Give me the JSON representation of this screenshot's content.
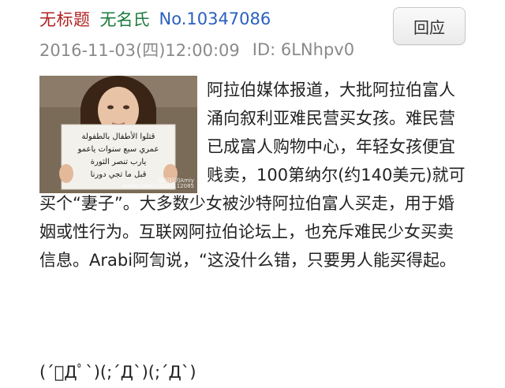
{
  "post": {
    "title": "无标题",
    "author": "无名氏",
    "number": "No.10347086",
    "datetime": "2016-11-03(四)12:00:09",
    "id": "ID: 6LNhpv0",
    "reply_label": "回应",
    "body": "阿拉伯媒体报道，大批阿拉伯富人涌向叙利亚难民营买女孩。难民营已成富人购物中心，年轻女孩便宜贱卖，100第纳尔(约140美元)就可买个“妻子”。大多数少女被沙特阿拉伯富人买走，用于婚姻或性行为。互联网阿拉伯论坛上，也充斥难民少女买卖信息。Arabi阿訇说，“这没什么错，只要男人能买得起。",
    "kaomoji": "(´ﾟДﾟ`)(;´Д`)(;´Д`)"
  },
  "image": {
    "sign_line_1": "قتلوا الأطفال بالطفولة",
    "sign_line_2": "عمري سبع سنوات ياعمو",
    "sign_line_3": "يارب تنصر الثورة",
    "sign_line_4": "قبل ما تجي دورنا",
    "watermark_1": "@叫好的Amiy",
    "watermark_2": "weibo.com/u/1881112085"
  },
  "colors": {
    "title": "#b22222",
    "author": "#1a7a3c",
    "number": "#2a5fbf",
    "meta": "#8a8a8a"
  }
}
